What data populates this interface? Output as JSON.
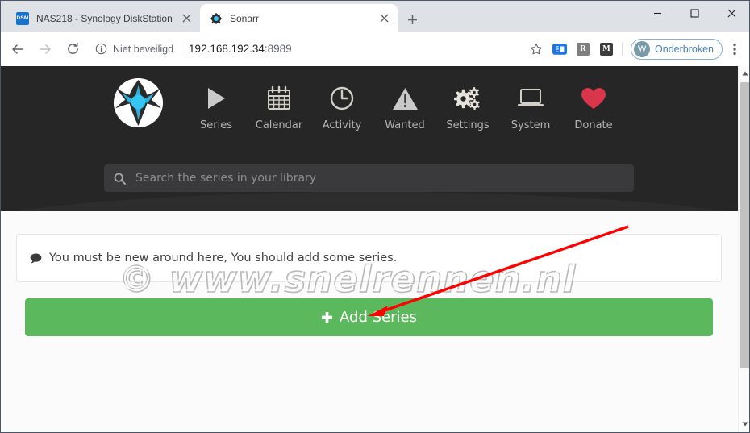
{
  "browser": {
    "tabs": [
      {
        "title": "NAS218 - Synology DiskStation",
        "favicon": "dsm-favicon",
        "favicon_label": "DSM",
        "active": false
      },
      {
        "title": "Sonarr",
        "favicon": "sonarr-favicon",
        "active": true
      }
    ],
    "new_tab_label": "+",
    "window_controls": {
      "minimize": "minimize",
      "maximize": "maximize",
      "close": "close"
    },
    "toolbar": {
      "back": "back-arrow",
      "forward": "forward-arrow",
      "reload": "reload",
      "security_text": "Niet beveiligd",
      "url": "192.168.192.34:8989",
      "url_host": "192.168.192.34",
      "url_port": ":8989",
      "bookmark_icon": "star-icon",
      "extensions": [
        {
          "name": "reading-list-extension",
          "label": "",
          "color": "#1a73e8"
        },
        {
          "name": "r-extension",
          "label": "R",
          "color": "#7f7f7f"
        },
        {
          "name": "gmail-extension",
          "label": "M",
          "color": "#3c3c3c"
        }
      ],
      "profile": {
        "avatar_initial": "W",
        "label": "Onderbroken"
      },
      "menu": "three-dots-menu"
    }
  },
  "sonarr": {
    "brand": "sonarr-logo",
    "nav": [
      {
        "label": "Series",
        "icon": "play-triangle-icon"
      },
      {
        "label": "Calendar",
        "icon": "calendar-icon"
      },
      {
        "label": "Activity",
        "icon": "clock-icon"
      },
      {
        "label": "Wanted",
        "icon": "warning-triangle-icon"
      },
      {
        "label": "Settings",
        "icon": "gears-icon"
      },
      {
        "label": "System",
        "icon": "laptop-icon"
      },
      {
        "label": "Donate",
        "icon": "heart-icon"
      }
    ],
    "search": {
      "placeholder": "Search the series in your library",
      "value": "",
      "icon": "search-icon"
    },
    "message": {
      "icon": "speech-bubble-icon",
      "text": "You must be new around here, You should add some series."
    },
    "add_button": {
      "label": "Add Series",
      "icon": "plus-icon"
    },
    "colors": {
      "header_bg": "#262626",
      "accent_green": "#5cb85c",
      "donate_red": "#d9364c",
      "logo_blue": "#35c6f4"
    }
  },
  "watermark": {
    "text": "© www.snelrennen.nl"
  },
  "annotation": {
    "type": "red-arrow",
    "color": "#ff0000"
  },
  "scrollbar": {
    "up": "scroll-up-arrow",
    "down": "scroll-down-arrow",
    "thumb": "scroll-thumb"
  }
}
